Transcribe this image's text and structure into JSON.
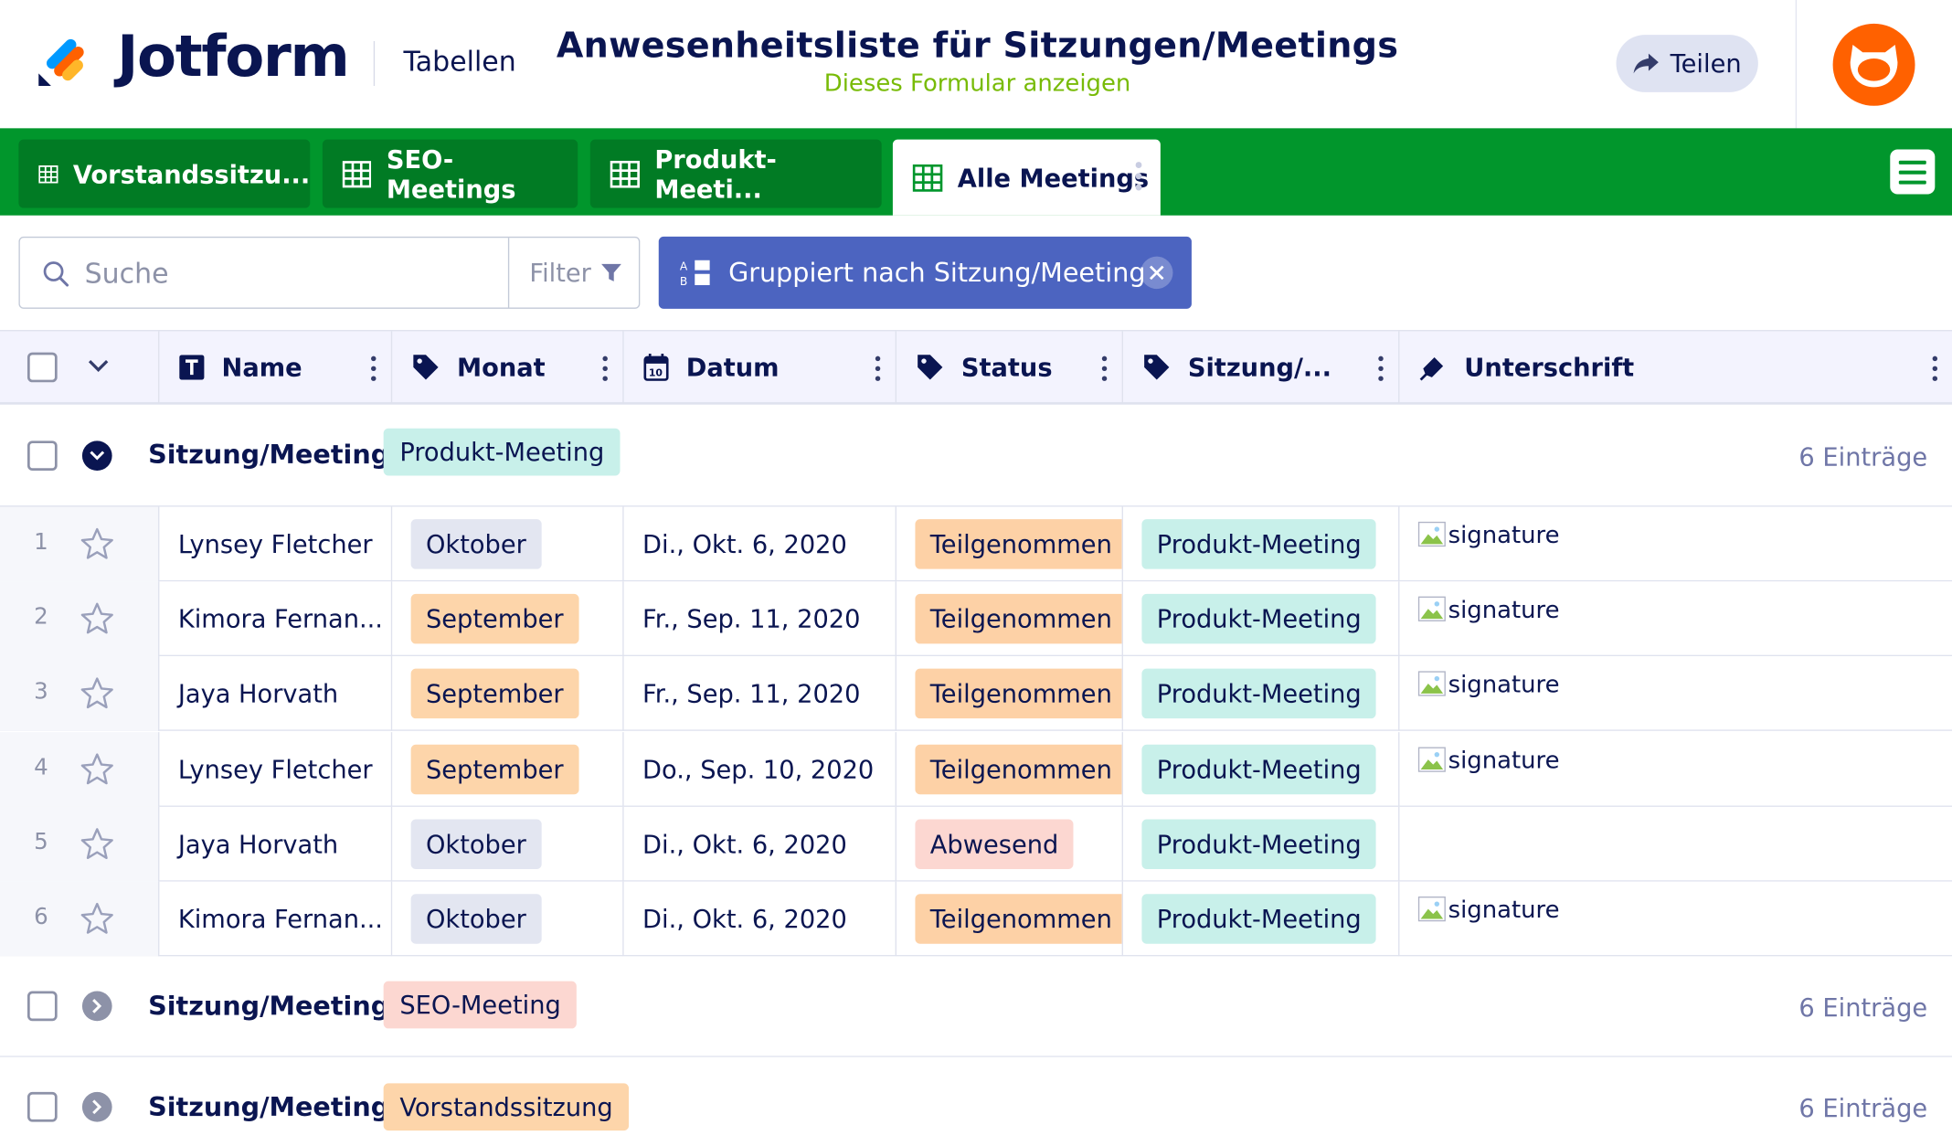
{
  "header": {
    "logo_text": "Jotform",
    "product": "Tabellen",
    "title": "Anwesenheitsliste für Sitzungen/Meetings",
    "view_form_link": "Dieses Formular anzeigen",
    "share_label": "Teilen"
  },
  "tabs": [
    {
      "label": "Vorstandssitzu...",
      "active": false
    },
    {
      "label": "SEO-Meetings",
      "active": false
    },
    {
      "label": "Produkt-Meeti...",
      "active": false
    },
    {
      "label": "Alle Meetings",
      "active": true
    }
  ],
  "toolbar": {
    "search_placeholder": "Suche",
    "filter_label": "Filter",
    "group_chip_label": "Gruppiert nach Sitzung/Meeting"
  },
  "columns": [
    "Name",
    "Monat",
    "Datum",
    "Status",
    "Sitzung/...",
    "Unterschrift"
  ],
  "group_prefix": "Sitzung/Meeting:",
  "groups": [
    {
      "value": "Produkt-Meeting",
      "count": "6 Einträge",
      "expanded": true,
      "color": "#c8f0ea"
    },
    {
      "value": "SEO-Meeting",
      "count": "6 Einträge",
      "expanded": false,
      "color": "#fcd7d1"
    },
    {
      "value": "Vorstandssitzung",
      "count": "6 Einträge",
      "expanded": false,
      "color": "#fdd5aa"
    }
  ],
  "rows": [
    {
      "num": "1",
      "name": "Lynsey Fletcher",
      "month": "Oktober",
      "date": "Di., Okt. 6, 2020",
      "status": "Teilgenommen",
      "meeting": "Produkt-Meeting",
      "signature": "signature"
    },
    {
      "num": "2",
      "name": "Kimora Fernan...",
      "month": "September",
      "date": "Fr., Sep. 11, 2020",
      "status": "Teilgenommen",
      "meeting": "Produkt-Meeting",
      "signature": "signature"
    },
    {
      "num": "3",
      "name": "Jaya Horvath",
      "month": "September",
      "date": "Fr., Sep. 11, 2020",
      "status": "Teilgenommen",
      "meeting": "Produkt-Meeting",
      "signature": "signature"
    },
    {
      "num": "4",
      "name": "Lynsey Fletcher",
      "month": "September",
      "date": "Do., Sep. 10, 2020",
      "status": "Teilgenommen",
      "meeting": "Produkt-Meeting",
      "signature": "signature"
    },
    {
      "num": "5",
      "name": "Jaya Horvath",
      "month": "Oktober",
      "date": "Di., Okt. 6, 2020",
      "status": "Abwesend",
      "meeting": "Produkt-Meeting",
      "signature": ""
    },
    {
      "num": "6",
      "name": "Kimora Fernan...",
      "month": "Oktober",
      "date": "Di., Okt. 6, 2020",
      "status": "Teilgenommen",
      "meeting": "Produkt-Meeting",
      "signature": "signature"
    }
  ],
  "colors": {
    "brand_green": "#01962c",
    "month_oktober": "#e3e6f1",
    "month_september": "#fdd5aa",
    "status_teilgenommen": "#fdd1a6",
    "status_abwesend": "#fcd7d1",
    "meeting_produkt": "#c8f0ea",
    "group_chip": "#4c64c0"
  }
}
